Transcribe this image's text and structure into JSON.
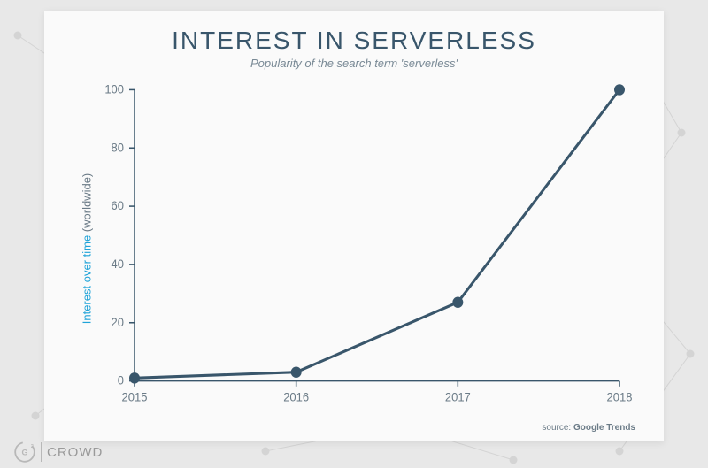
{
  "title": "INTEREST IN SERVERLESS",
  "subtitle": "Popularity of the search term 'serverless'",
  "yaxis": {
    "label_blue": "Interest over time",
    "label_gray": " (worldwide)"
  },
  "source": {
    "prefix": "source: ",
    "name": "Google Trends"
  },
  "brand": {
    "text": "CROWD"
  },
  "chart_data": {
    "type": "line",
    "categories": [
      "2015",
      "2016",
      "2017",
      "2018"
    ],
    "values": [
      1,
      3,
      27,
      100
    ],
    "title": "INTEREST IN SERVERLESS",
    "xlabel": "",
    "ylabel": "Interest over time (worldwide)",
    "ylim": [
      0,
      100
    ],
    "yticks": [
      0,
      20,
      40,
      60,
      80,
      100
    ]
  }
}
